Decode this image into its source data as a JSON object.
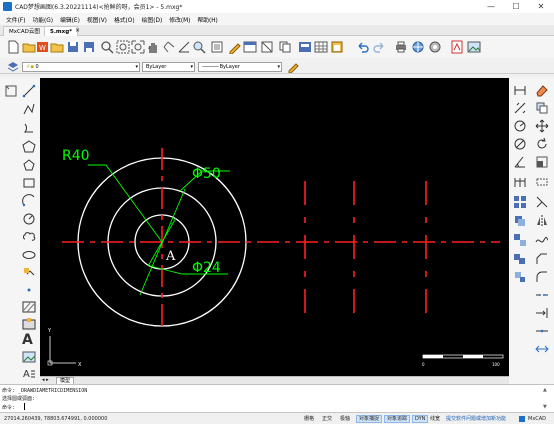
{
  "window": {
    "title": "CAD梦想画图(6.3.20221114)<抢鲜的呀，会员1> - 5.mxg*",
    "controls": [
      "—",
      "☐",
      "✕"
    ]
  },
  "menu": [
    "文件(F)",
    "功能(G)",
    "编辑(E)",
    "视图(V)",
    "格式(O)",
    "绘图(D)",
    "修改(M)",
    "帮助(H)"
  ],
  "doc_tabs": [
    "MxCAD云图",
    "5.mxg*"
  ],
  "layer_bar": {
    "layer_name": "0",
    "color": "ByLayer",
    "linetype": "ByLayer"
  },
  "drawing": {
    "labels": {
      "radius": "R40",
      "dia_outer": "Φ50",
      "dia_inner": "Φ24",
      "point": "A"
    },
    "ucs": {
      "x": "X",
      "y": "Y"
    },
    "scale_bar": {
      "start": "0",
      "end": "100"
    }
  },
  "colors": {
    "dimension": "#00ff00",
    "centerline": "#ff2020",
    "circle": "#ffffff",
    "canvas": "#000000"
  },
  "model_tabs": [
    "模型"
  ],
  "command": {
    "history_1": "命令: _DRAWDIAMETRICDIMENSION",
    "history_2": "选择圆或弧面:",
    "prompt": "命令:"
  },
  "status": {
    "coords": "27014.260439, 78803.674991, 0.000000",
    "toggles": [
      "栅格",
      "正交",
      "极轴",
      "对象捕捉",
      "对象追踪",
      "DYN",
      "线宽",
      "提交软件问题或增加新功能"
    ],
    "brand": "MxCAD"
  }
}
